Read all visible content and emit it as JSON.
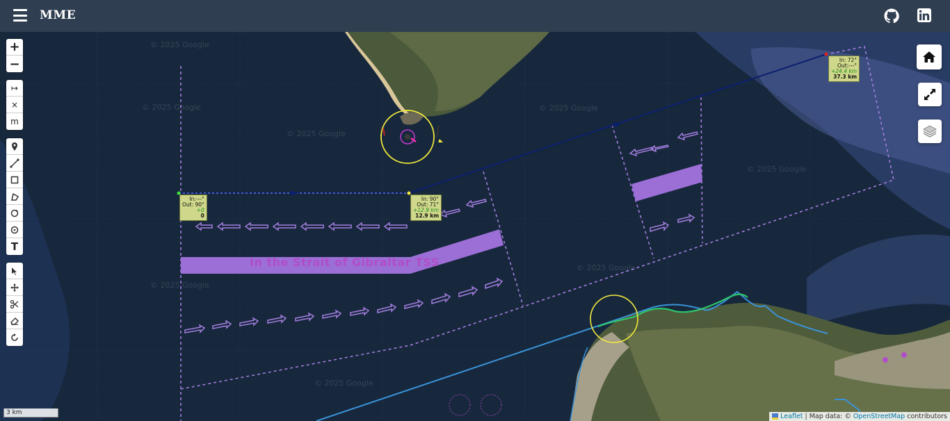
{
  "app": {
    "title": "MME"
  },
  "header": {
    "github_label": "GitHub",
    "linkedin_label": "LinkedIn"
  },
  "map": {
    "tss_label": "In the Strait of Gibraltar TSS",
    "watermark": "© 2025 Google",
    "scale_label": "3 km",
    "attribution": {
      "leaflet": "Leaflet",
      "sep": " | Map data: © ",
      "osm": "OpenStreetMap",
      "tail": " contributors"
    }
  },
  "zoom": {
    "in": "+",
    "out": "−"
  },
  "tools": {
    "measure_label": "↦",
    "clear_label": "×",
    "units_label": "m",
    "text_label": "T"
  },
  "waypoints": [
    {
      "in": "In:---°",
      "out": "Out: 90°",
      "delta": "+0",
      "total": "0"
    },
    {
      "in": "In: 90°",
      "out": "Out: 71°",
      "delta": "+12.9 km",
      "total": "12.9 km"
    },
    {
      "in": "In: 72°",
      "out": "Out:---°",
      "delta": "+24.4 km",
      "total": "37.3 km"
    }
  ],
  "colors": {
    "topbar": "#2f3e51",
    "sea": "#17283d",
    "tss_purple": "#9b6fd6",
    "route": "#0b1f6e",
    "label_bg": "#cfd88a",
    "coast_blue": "#3a93d8",
    "coast_green": "#2fc46a",
    "circle_yellow": "#f2e93b"
  }
}
